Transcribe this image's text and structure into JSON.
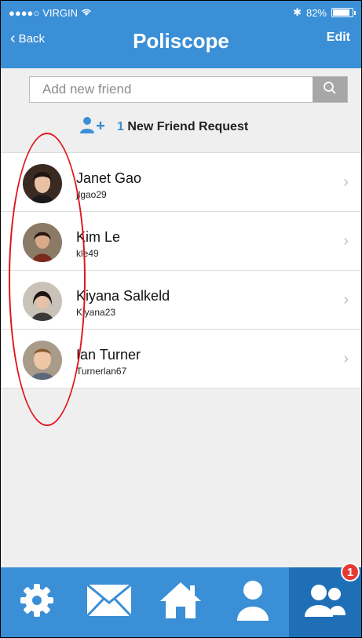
{
  "status_bar": {
    "carrier": "VIRGIN",
    "battery": "82%"
  },
  "nav": {
    "back_label": "Back",
    "title": "Poliscope",
    "edit_label": "Edit"
  },
  "search": {
    "placeholder": "Add new friend"
  },
  "friend_request": {
    "count": "1",
    "label": "New Friend Request"
  },
  "friends": [
    {
      "name": "Janet Gao",
      "username": "jlgao29"
    },
    {
      "name": "Kim Le",
      "username": "kle49"
    },
    {
      "name": "Kiyana Salkeld",
      "username": "Kiyana23"
    },
    {
      "name": "Ian Turner",
      "username": "Turnerlan67"
    }
  ],
  "tabbar": {
    "badge": "1",
    "tabs": [
      "settings-icon",
      "mail-icon",
      "home-icon",
      "profile-icon",
      "friends-icon"
    ]
  },
  "colors": {
    "header": "#3a8fd6",
    "tab_active": "#1f6fb7",
    "annotation": "#e0151c",
    "badge": "#e53a32"
  }
}
